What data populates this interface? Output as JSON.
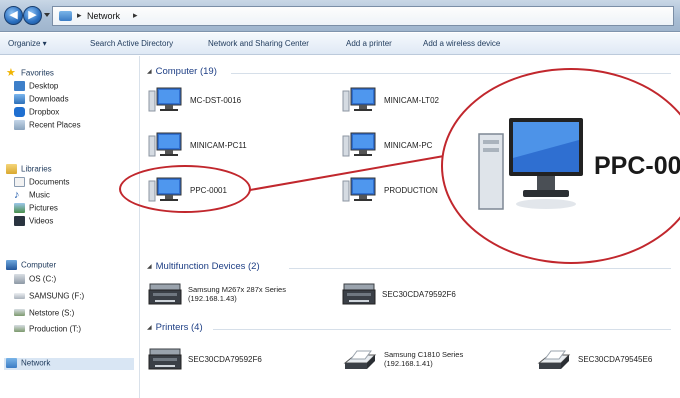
{
  "address": {
    "location": "Network",
    "separator": "▸"
  },
  "toolbar": {
    "organize": "Organize ▾",
    "search_ad": "Search Active Directory",
    "network_sharing": "Network and Sharing Center",
    "add_printer": "Add a printer",
    "add_wireless": "Add a wireless device"
  },
  "sidebar": {
    "favorites": "Favorites",
    "desktop": "Desktop",
    "downloads": "Downloads",
    "dropbox": "Dropbox",
    "recent_places": "Recent Places",
    "libraries": "Libraries",
    "documents": "Documents",
    "music": "Music",
    "pictures": "Pictures",
    "videos": "Videos",
    "computer": "Computer",
    "os_c": "OS (C:)",
    "samsung_f": "SAMSUNG (F:)",
    "netstore_s": "Netstore (S:)",
    "production_t": "Production (T:)",
    "network": "Network"
  },
  "groups": {
    "computer": "Computer (19)",
    "multifunction": "Multifunction Devices (2)",
    "printers": "Printers (4)"
  },
  "computers": [
    "MC-DST-0016",
    "MINICAM-LT02",
    "MINICAM-PC11",
    "MINICAM-PC",
    "PPC-0001",
    "PRODUCTION"
  ],
  "multifunction": {
    "item1_line1": "Samsung M267x 287x Series",
    "item1_line2": "(192.168.1.43)",
    "item2": "SEC30CDA79592F6"
  },
  "printers": {
    "item1": "SEC30CDA79592F6",
    "item2_line1": "Samsung C1810 Series",
    "item2_line2": "(192.168.1.41)",
    "item3": "SEC30CDA79545E6"
  },
  "zoom": {
    "label": "PPC-00"
  },
  "colors": {
    "highlight_circle": "#c1272d",
    "group_header": "#1e3f85"
  }
}
